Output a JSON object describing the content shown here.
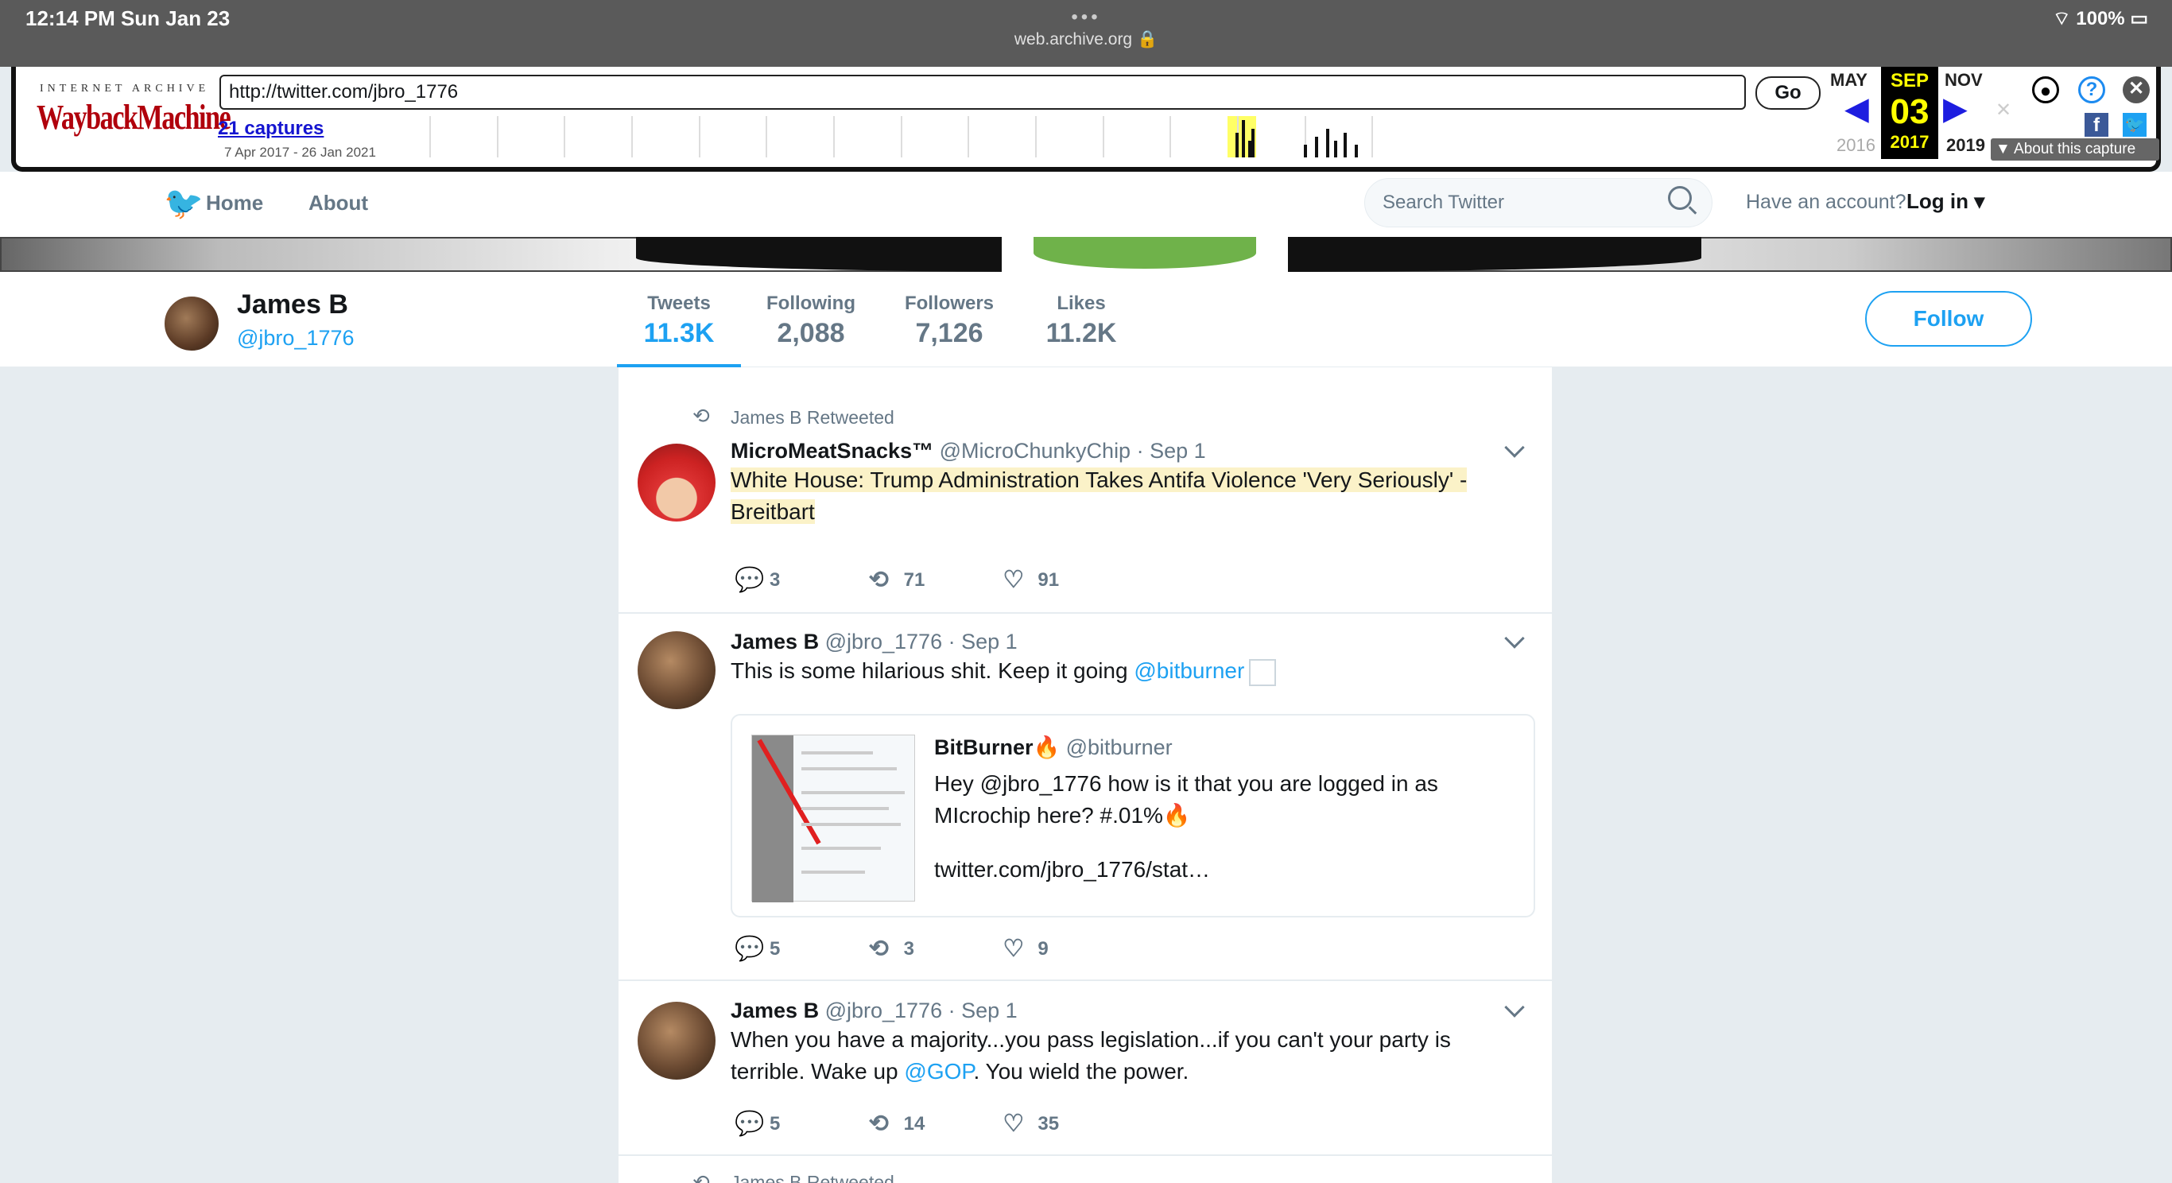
{
  "status_bar": {
    "time": "12:14 PM   Sun Jan 23",
    "url": "web.archive.org 🔒",
    "dots": "•••",
    "battery": "100%"
  },
  "wayback": {
    "logo_top": "INTERNET ARCHIVE",
    "logo": "WaybackMachine",
    "url_value": "http://twitter.com/jbro_1776",
    "go_label": "Go",
    "captures": "21 captures",
    "range": "7 Apr 2017 - 26 Jan 2021",
    "prev_month": "MAY",
    "cur_month": "SEP",
    "next_month": "NOV",
    "cur_day": "03",
    "prev_year": "2016",
    "cur_year": "2017",
    "next_year": "2019",
    "about_capture": "▼ About this capture",
    "capture_bar_levels": [
      0.6,
      0.9,
      0.4,
      0.7,
      0.3,
      0.5,
      0.7,
      0.4,
      0.6,
      0.3
    ]
  },
  "nav": {
    "home": "Home",
    "about": "About",
    "search_placeholder": "Search Twitter",
    "have_account": "Have an account?",
    "login": "Log in ▾"
  },
  "profile": {
    "name": "James B",
    "handle": "@jbro_1776",
    "stats": [
      {
        "label": "Tweets",
        "value": "11.3K"
      },
      {
        "label": "Following",
        "value": "2,088"
      },
      {
        "label": "Followers",
        "value": "7,126"
      },
      {
        "label": "Likes",
        "value": "11.2K"
      }
    ],
    "follow_label": "Follow"
  },
  "tweets": [
    {
      "retweeted_by": "James B Retweeted",
      "name": "MicroMeatSnacks™",
      "meta": " @MicroChunkyChip · Sep 1",
      "text": "White House: Trump Administration Takes Antifa Violence 'Very Seriously' - Breitbart",
      "replies": "3",
      "retweets": "71",
      "likes": "91"
    },
    {
      "name": "James B",
      "meta": " @jbro_1776 · Sep 1",
      "text": "This is some hilarious shit. Keep it going ",
      "mention": "@bitburner",
      "quote": {
        "name": "BitBurner🔥",
        "handle": " @bitburner",
        "text": "Hey @jbro_1776 how is it that you are logged in as MIcrochip here? #.01%🔥",
        "link": "twitter.com/jbro_1776/stat…"
      },
      "replies": "5",
      "retweets": "3",
      "likes": "9"
    },
    {
      "name": "James B",
      "meta": " @jbro_1776 · Sep 1",
      "text_before": "When you have a majority...you pass legislation...if you can't your party is terrible. Wake up ",
      "mention": "@GOP",
      "text_after": ". You wield the power.",
      "replies": "5",
      "retweets": "14",
      "likes": "35"
    }
  ],
  "next_retweet_label": "James B Retweeted",
  "colors": {
    "twitter_blue": "#1da1f2",
    "wayback_red": "#b0000c",
    "highlight": "#fbf2c8"
  }
}
